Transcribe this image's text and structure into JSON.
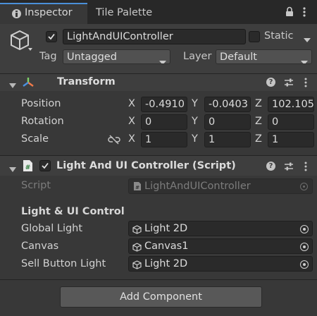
{
  "tabs": [
    {
      "label": "Inspector"
    },
    {
      "label": "Tile Palette"
    }
  ],
  "gameobject": {
    "name": "LightAndUIController",
    "static_label": "Static",
    "tag_label": "Tag",
    "tag_value": "Untagged",
    "layer_label": "Layer",
    "layer_value": "Default"
  },
  "transform": {
    "title": "Transform",
    "position_label": "Position",
    "rotation_label": "Rotation",
    "scale_label": "Scale",
    "axes": [
      "X",
      "Y",
      "Z"
    ],
    "position": [
      "-0.4910",
      "-0.0403",
      "102.105"
    ],
    "rotation": [
      "0",
      "0",
      "0"
    ],
    "scale": [
      "1",
      "1",
      "1"
    ]
  },
  "script_component": {
    "title": "Light And UI Controller (Script)",
    "script_label": "Script",
    "script_value": "LightAndUIController",
    "section_header": "Light & UI Control",
    "fields": [
      {
        "label": "Global Light",
        "value": "Light 2D"
      },
      {
        "label": "Canvas",
        "value": "Canvas1"
      },
      {
        "label": "Sell Button Light",
        "value": "Light 2D"
      }
    ]
  },
  "add_component_label": "Add Component",
  "colors": {
    "background": "#383838",
    "header": "#3e3e3e",
    "tab_bar": "#282828",
    "field": "#2a2a2a"
  }
}
